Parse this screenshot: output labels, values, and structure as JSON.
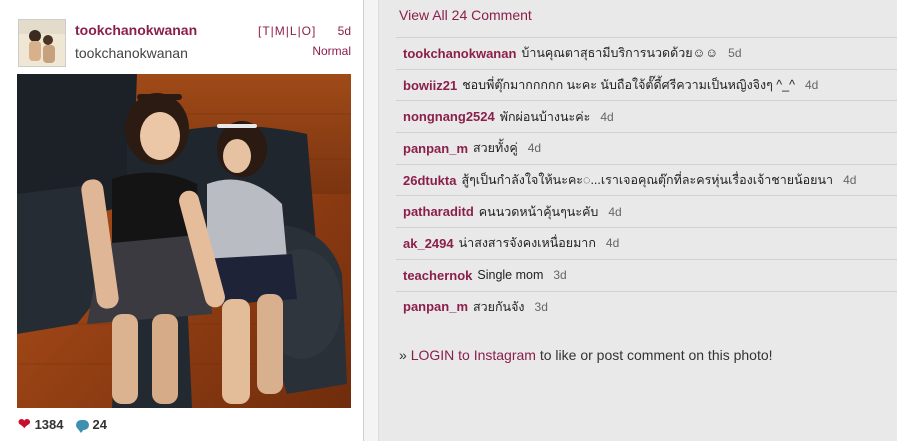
{
  "post": {
    "username": "tookchanokwanan",
    "display_name": "tookchanokwanan",
    "sizes": "[T|M|L|O]",
    "age": "5d",
    "filter": "Normal",
    "likes": "1384",
    "comments": "24"
  },
  "icons": {
    "like": "heart-icon",
    "comment": "comment-bubble-icon"
  },
  "view_all": "View All 24 Comment",
  "comments": [
    {
      "user": "tookchanokwanan",
      "text": "บ้านคุณตาสุธามีบริการนวดด้วย☺☺",
      "time": "5d"
    },
    {
      "user": "bowiiz21",
      "text": "ชอบพี่ตุ๊กมากกกกก นะคะ นับถือใจ้ตั๊ดี้ศรีความเป็นหญิงจิงๆ ^_^",
      "time": "4d"
    },
    {
      "user": "nongnang2524",
      "text": "พักผ่อนบ้างนะค่ะ",
      "time": "4d"
    },
    {
      "user": "panpan_m",
      "text": "สวยทั้งคู่",
      "time": "4d"
    },
    {
      "user": "26dtukta",
      "text": "สู้ๆเป็นกำลังใจให้นะคะ◌...เราเจอคุณตุ๊กที่ละครหุ่นเรื่องเจ้าชายน้อยนา",
      "time": "4d"
    },
    {
      "user": "patharaditd",
      "text": "คนนวดหน้าคุ้นๆนะคับ",
      "time": "4d"
    },
    {
      "user": "ak_2494",
      "text": "น่าสงสารจังคงเหนื่อยมาก",
      "time": "4d"
    },
    {
      "user": "teachernok",
      "text": "Single mom",
      "time": "3d"
    },
    {
      "user": "panpan_m",
      "text": "สวยกันจัง",
      "time": "3d"
    }
  ],
  "login": {
    "prefix": "» ",
    "link": "LOGIN to Instagram",
    "suffix": " to like or post comment on this photo!"
  }
}
